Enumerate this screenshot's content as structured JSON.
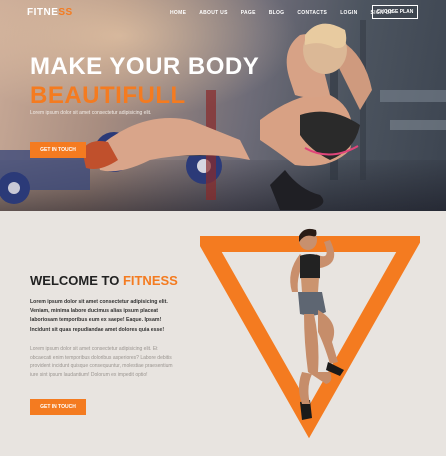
{
  "brand": {
    "logo_text_main": "FITNE",
    "logo_text_accent": "SS",
    "accent_color": "#f47b20"
  },
  "nav": {
    "items": [
      {
        "label": "HOME"
      },
      {
        "label": "ABOUT US"
      },
      {
        "label": "PAGE"
      },
      {
        "label": "BLOG"
      },
      {
        "label": "CONTACTS"
      },
      {
        "label": "LOGIN"
      },
      {
        "label": "SIGN UP"
      }
    ],
    "cta_label": "CHOOSE PLAN"
  },
  "hero": {
    "title_line1": "MAKE YOUR BODY",
    "title_line2": "BEAUTIFULL",
    "subtitle": "Lorem ipsum dolor sit amet consectetur adipisicing elit.",
    "button_label": "GET IN TOUCH"
  },
  "about": {
    "heading_main": "WELCOME TO ",
    "heading_accent": "FITNESS",
    "bold_paragraph": "Lorem ipsum dolor sit amet consectetur adipisicing elit. Veniam, minima labore ducimus alias ipsum placeat laboriosam temporibus eum ex saepe! Eaque. Ipsam! Incidunt sit quas repudiandae amet dolores quia esse!",
    "light_paragraph": "Lorem ipsum dolor sit amet consectetur adipisicing elit. Et obcaecati enim temporibus doloribus asperiores? Labore debitis provident incidunt quisque consequuntur, molestiae praesentium iure sint ipsum laudantium! Dolorum ex impedit optio!",
    "button_label": "GET IN TOUCH"
  }
}
